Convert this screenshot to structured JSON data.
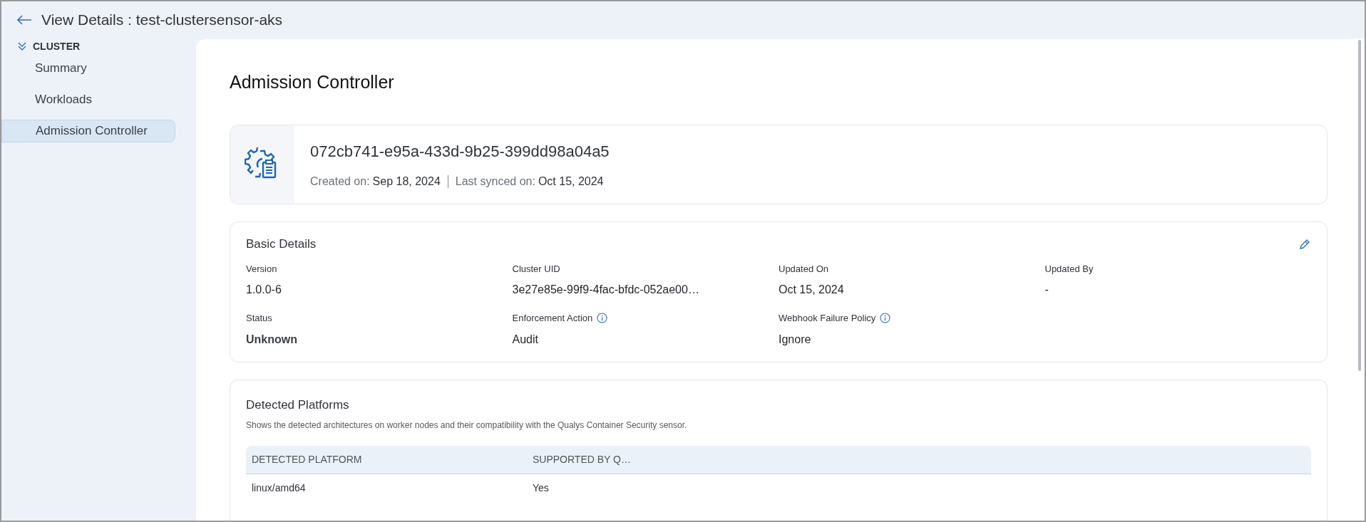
{
  "header": {
    "title": "View Details : test-clustersensor-aks"
  },
  "sidebar": {
    "group": {
      "label": "CLUSTER",
      "expanded": true
    },
    "items": [
      {
        "label": "Summary",
        "selected": false
      },
      {
        "label": "Workloads",
        "selected": false
      },
      {
        "label": "Admission Controller",
        "selected": true
      }
    ]
  },
  "page_title": "Admission Controller",
  "summary_card": {
    "id": "072cb741-e95a-433d-9b25-399dd98a04a5",
    "created_label": "Created on:",
    "created": "Sep 18, 2024",
    "synced_label": "Last synced on:",
    "synced": "Oct 15, 2024"
  },
  "basic_details": {
    "title": "Basic Details",
    "fields": [
      {
        "label": "Version",
        "value": "1.0.0-6",
        "info": false,
        "strong": false
      },
      {
        "label": "Cluster UID",
        "value": "3e27e85e-99f9-4fac-bfdc-052ae00…",
        "info": false,
        "strong": false
      },
      {
        "label": "Updated On",
        "value": "Oct 15, 2024",
        "info": false,
        "strong": false
      },
      {
        "label": "Updated By",
        "value": "-",
        "info": false,
        "strong": false
      },
      {
        "label": "Status",
        "value": "Unknown",
        "info": false,
        "strong": true
      },
      {
        "label": "Enforcement Action",
        "value": "Audit",
        "info": true,
        "strong": false
      },
      {
        "label": "Webhook Failure Policy",
        "value": "Ignore",
        "info": true,
        "strong": false
      }
    ]
  },
  "detected_platforms": {
    "title": "Detected Platforms",
    "description": "Shows the detected architectures on worker nodes and their compatibility with the Qualys Container Security sensor.",
    "table": {
      "columns": [
        "DETECTED PLATFORM",
        "SUPPORTED BY Q…"
      ],
      "rows": [
        [
          "linux/amd64",
          "Yes"
        ]
      ]
    }
  }
}
